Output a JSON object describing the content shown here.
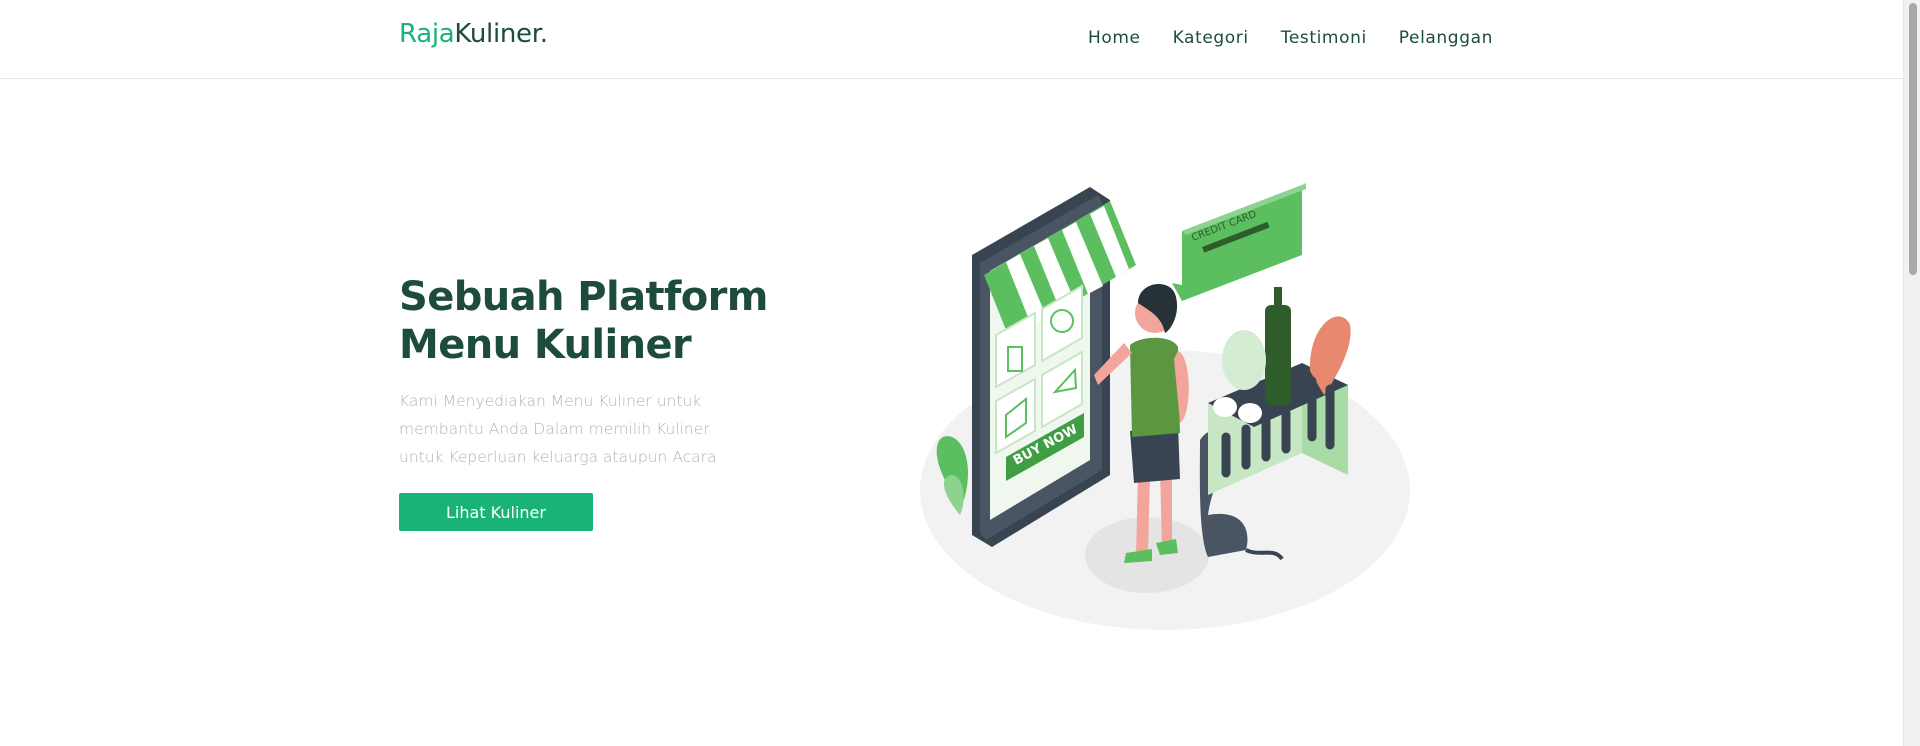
{
  "brand": {
    "accent": "Raja",
    "rest": "Kuliner."
  },
  "nav": {
    "items": [
      {
        "label": "Home"
      },
      {
        "label": "Kategori"
      },
      {
        "label": "Testimoni"
      },
      {
        "label": "Pelanggan"
      }
    ]
  },
  "hero": {
    "title_line1": "Sebuah Platform",
    "title_line2": "Menu Kuliner",
    "description": "Kami Menyediakan Menu Kuliner untuk membantu Anda Dalam memilih Kuliner untuk Keperluan keluarga ataupun Acara",
    "cta_label": "Lihat Kuliner"
  },
  "illustration": {
    "card_text": "CREDIT CARD",
    "buy_text": "BUY NOW"
  },
  "colors": {
    "accent": "#19b277",
    "heading": "#1d4d3a",
    "muted_text": "#b3b3b3",
    "illustration_green": "#5bbf5f"
  }
}
